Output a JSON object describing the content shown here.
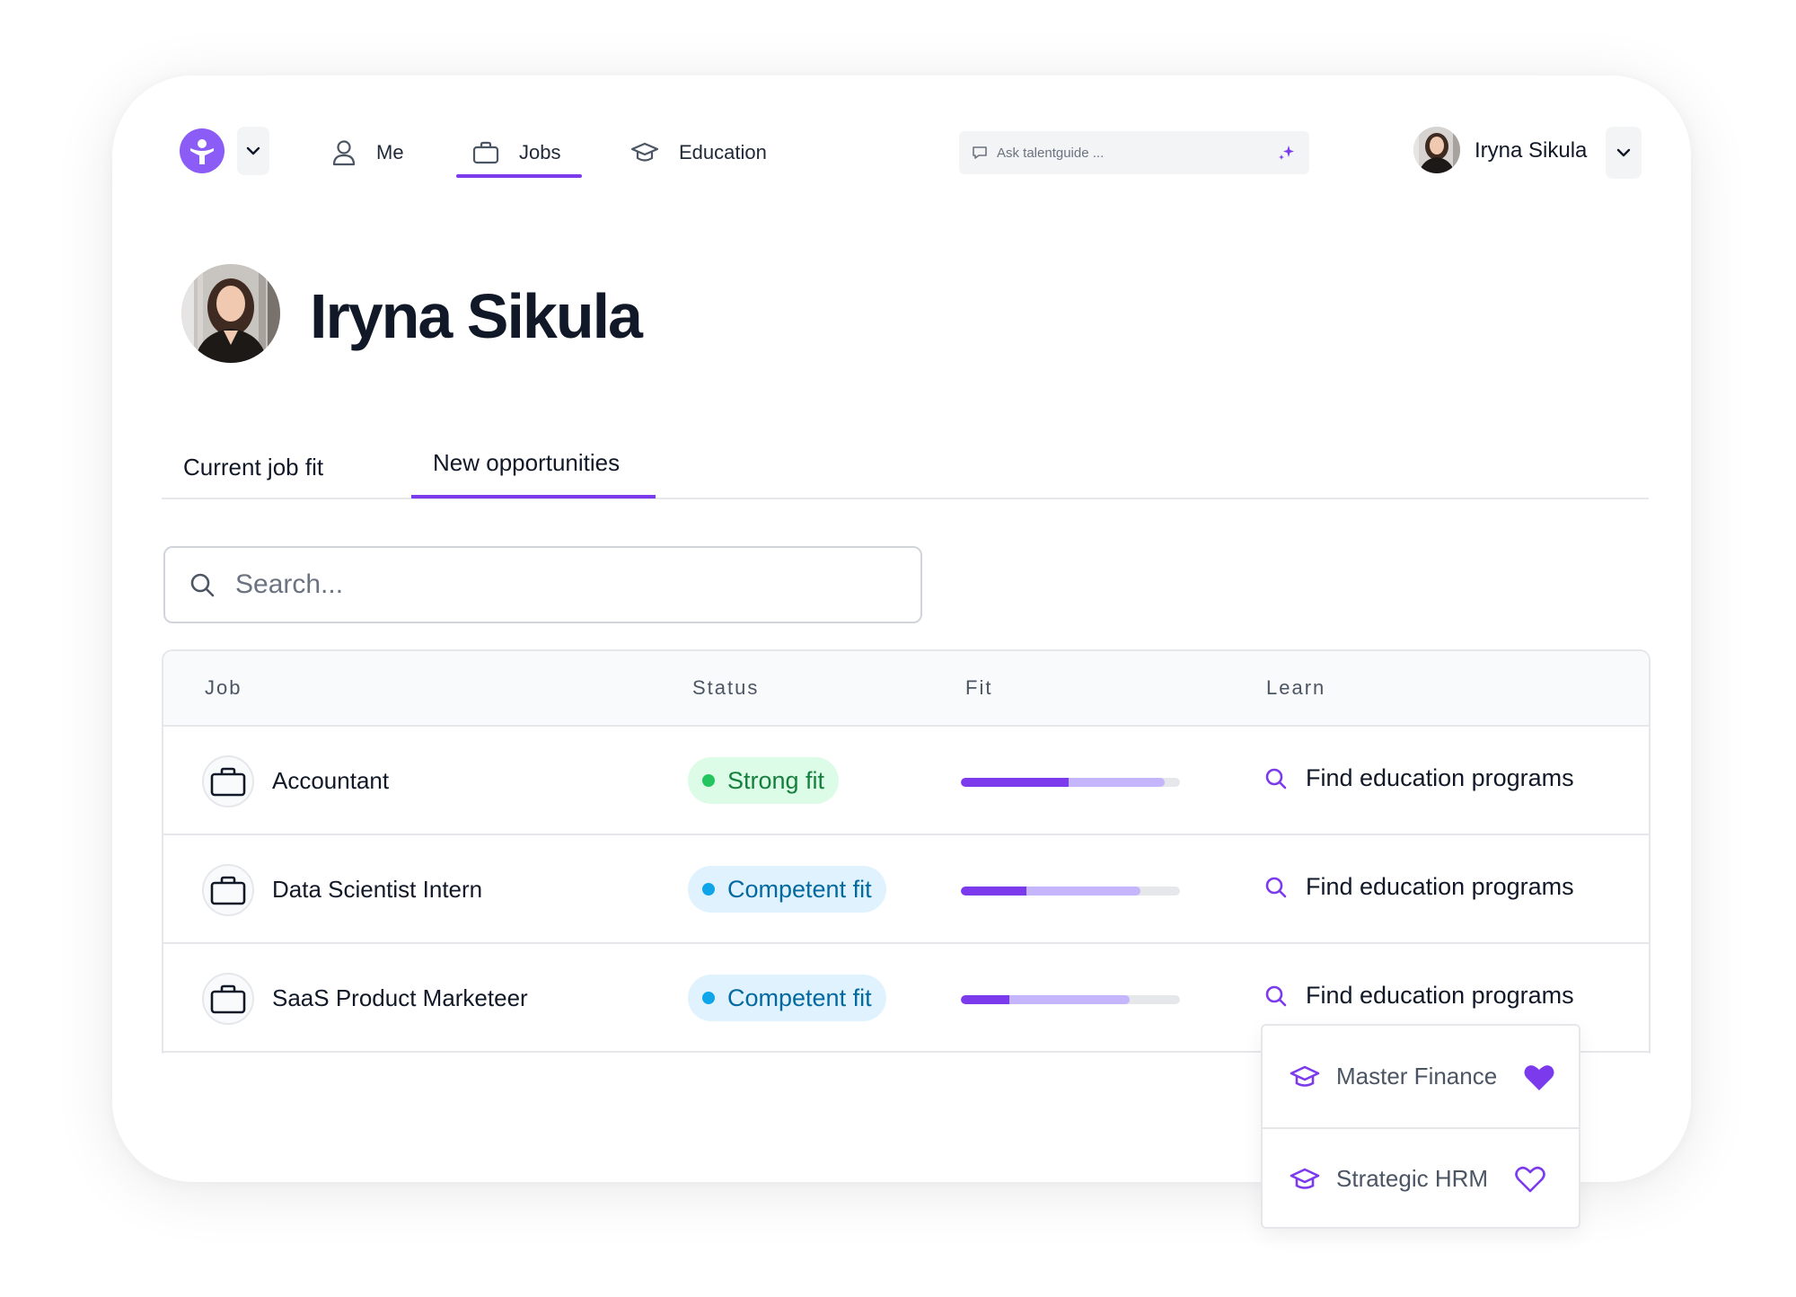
{
  "nav": {
    "items": [
      {
        "label": "Me",
        "icon": "user-icon"
      },
      {
        "label": "Jobs",
        "icon": "briefcase-icon",
        "active": true
      },
      {
        "label": "Education",
        "icon": "graduation-cap-icon"
      }
    ],
    "ask_placeholder": "Ask talentguide ...",
    "user_name": "Iryna Sikula"
  },
  "profile": {
    "name": "Iryna Sikula"
  },
  "tabs": [
    {
      "label": "Current job fit",
      "active": false
    },
    {
      "label": "New opportunities",
      "active": true
    }
  ],
  "search": {
    "placeholder": "Search..."
  },
  "table": {
    "headers": [
      "Job",
      "Status",
      "Fit",
      "Learn"
    ],
    "rows": [
      {
        "job": "Accountant",
        "status": "Strong fit",
        "status_kind": "strong",
        "fit_strong": 0.49,
        "fit_total": 0.93,
        "learn": "Find education programs"
      },
      {
        "job": "Data Scientist Intern",
        "status": "Competent fit",
        "status_kind": "competent",
        "fit_strong": 0.3,
        "fit_total": 0.82,
        "learn": "Find education programs"
      },
      {
        "job": "SaaS Product Marketeer",
        "status": "Competent fit",
        "status_kind": "competent",
        "fit_strong": 0.22,
        "fit_total": 0.77,
        "learn": "Find education programs"
      }
    ]
  },
  "dropdown": {
    "items": [
      {
        "label": "Master Finance",
        "favorited": true
      },
      {
        "label": "Strategic HRM",
        "favorited": false
      }
    ]
  },
  "colors": {
    "accent": "#7c3aed",
    "brand": "#8b5cf6",
    "strong_fit": "#15803d",
    "competent_fit": "#0369a1"
  }
}
